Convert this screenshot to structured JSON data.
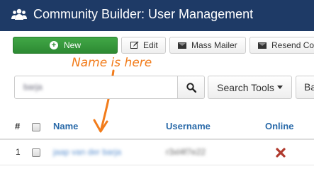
{
  "header": {
    "title": "Community Builder: User Management",
    "icon": "users-icon"
  },
  "toolbar": {
    "new_label": "New",
    "edit_label": "Edit",
    "mass_mailer_label": "Mass Mailer",
    "resend_label": "Resend Co"
  },
  "search": {
    "value": "barja",
    "search_tools_label": "Search Tools",
    "ba_label": "Ba"
  },
  "table": {
    "columns": {
      "hash": "#",
      "name": "Name",
      "username": "Username",
      "online": "Online"
    },
    "rows": [
      {
        "num": "1",
        "name": "jaap van der barja",
        "username": "r3xl4f7e22",
        "online": "offline-x-icon"
      }
    ]
  },
  "annotation": {
    "text": "Name is here"
  },
  "colors": {
    "header_bg": "#1e3a66",
    "new_button": "#2d8a33",
    "link_blue": "#2a6aa9",
    "annotation_orange": "#f27c1b",
    "offline_red": "#b03a2e"
  }
}
